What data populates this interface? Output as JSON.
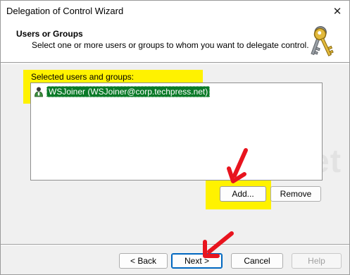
{
  "window": {
    "title": "Delegation of Control Wizard",
    "close_glyph": "✕"
  },
  "header": {
    "title": "Users or Groups",
    "subtitle": "Select one or more users or groups to whom you want to delegate control.",
    "icon": "keys-icon"
  },
  "selection": {
    "label": "Selected users and groups:",
    "items": [
      {
        "text": "WSJoiner (WSJoiner@corp.techpress.net)",
        "icon": "user-icon",
        "selected": true
      }
    ]
  },
  "list_buttons": {
    "add": "Add...",
    "remove": "Remove"
  },
  "footer": {
    "back": "< Back",
    "next": "Next >",
    "cancel": "Cancel",
    "help": "Help"
  },
  "watermark": "TechPress.net",
  "colors": {
    "highlight": "#fff200",
    "selection": "#0a7a28",
    "annotation_arrow": "#e8141e",
    "default_button_border": "#0067c0"
  }
}
